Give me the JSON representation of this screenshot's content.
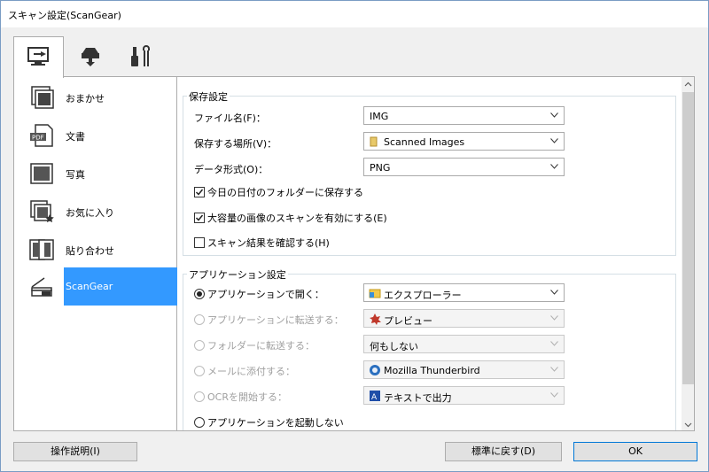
{
  "window": {
    "title": "スキャン設定(ScanGear)"
  },
  "tabs": [
    {
      "name": "scan-from-computer-tab",
      "icon": "computer-scan-icon"
    },
    {
      "name": "scanner-settings-tab",
      "icon": "scanner-button-icon"
    },
    {
      "name": "general-settings-tab",
      "icon": "tools-icon"
    }
  ],
  "sidebar": {
    "items": [
      {
        "label": "おまかせ",
        "icon": "auto-scan-icon"
      },
      {
        "label": "文書",
        "icon": "pdf-document-icon"
      },
      {
        "label": "写真",
        "icon": "photo-icon"
      },
      {
        "label": "お気に入り",
        "icon": "favorite-icon"
      },
      {
        "label": "貼り合わせ",
        "icon": "stitch-icon"
      },
      {
        "label": "ScanGear",
        "icon": "scangear-icon",
        "selected": true
      }
    ]
  },
  "save_settings": {
    "title": "保存設定",
    "filename_label": "ファイル名(F)：",
    "filename_value": "IMG",
    "location_label": "保存する場所(V)：",
    "location_value": "Scanned Images",
    "format_label": "データ形式(O)：",
    "format_value": "PNG",
    "chk_date_folder": "今日の日付のフォルダーに保存する",
    "chk_large_image": "大容量の画像のスキャンを有効にする(E)",
    "chk_check_result": "スキャン結果を確認する(H)"
  },
  "app_settings": {
    "title": "アプリケーション設定",
    "open_app_label": "アプリケーションで開く：",
    "open_app_value": "エクスプローラー",
    "send_app_label": "アプリケーションに転送する：",
    "send_app_value": "プレビュー",
    "send_folder_label": "フォルダーに転送する：",
    "send_folder_value": "何もしない",
    "attach_mail_label": "メールに添付する：",
    "attach_mail_value": "Mozilla Thunderbird",
    "start_ocr_label": "OCRを開始する：",
    "start_ocr_value": "テキストで出力",
    "no_app_label": "アプリケーションを起動しない"
  },
  "buttons": {
    "instructions": "操作説明(I)",
    "defaults": "標準に戻す(D)",
    "ok": "OK"
  },
  "colors": {
    "selection": "#3399ff",
    "default_button_border": "#0078d7"
  }
}
